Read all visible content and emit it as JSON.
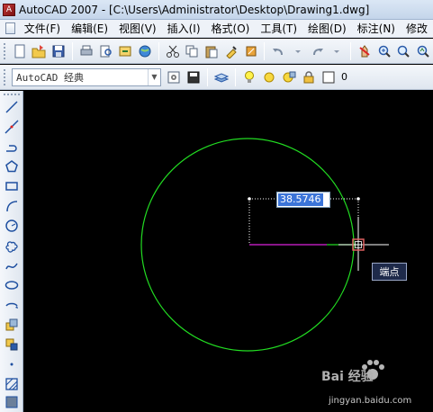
{
  "window": {
    "title": "AutoCAD 2007 - [C:\\Users\\Administrator\\Desktop\\Drawing1.dwg]",
    "app_icon": "A"
  },
  "menubar": {
    "items": [
      "文件(F)",
      "编辑(E)",
      "视图(V)",
      "插入(I)",
      "格式(O)",
      "工具(T)",
      "绘图(D)",
      "标注(N)",
      "修改"
    ]
  },
  "toolbar2": {
    "workspace_value": "AutoCAD 经典",
    "layer_value": "0"
  },
  "canvas": {
    "dynamic_input_value": "38.5746",
    "osnap_tooltip": "端点",
    "colors": {
      "circle": "#22dd22",
      "radius_line": "#dd22dd",
      "crosshair": "#ffffff",
      "osnap_marker": "#e06060",
      "background": "#000000"
    }
  },
  "watermark": {
    "brand": "Bai 经验",
    "url": "jingyan.baidu.com"
  }
}
